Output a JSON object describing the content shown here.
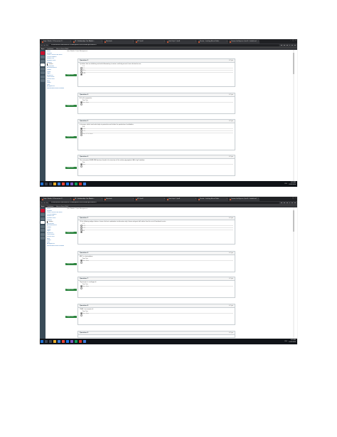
{
  "screens": [
    {
      "tabs": [
        "Topic: Module 3 Discussion (P...",
        "QT - Scholarship - For Module...",
        "Notebook",
        "MT Quiz8",
        "Quiz Help 1 Quiz8",
        "Proctor - Looking Ahead Guide",
        "Canvas Intelligence-Quiz 8 - Lookahead"
      ],
      "url": "fiu.instructure.com/courses/759960/quizzes/780010/take/questions/10",
      "bookmarks": [
        "Apps",
        "Lockdown",
        "Access Saved Rutil"
      ],
      "breadcrumb": "Quiz: Module 3 Quiz 8 Assignment",
      "course_nav": [
        "Home",
        "Syllabus",
        "Online Course Plan Starts",
        "Course Modules",
        "Module Info",
        "Syllabus Items",
        "Modules",
        "Quizzes",
        "Discussions",
        "Announcements",
        "Grades",
        "Collab",
        "Pages",
        "Resources",
        "Office Hours",
        "Course Tools",
        "FAQs",
        "People",
        "Tools",
        "Assignments",
        "Submit Assessment Feedback"
      ],
      "current_nav": "Quizzes",
      "flag_label": "Flag question",
      "questions": [
        {
          "title": "Question 3",
          "points": "0.7 pts",
          "text": "Cytokines that are inhibitory and anti-inflammatory in nature, and help prevent tissue destruction are:",
          "answers": [
            "IL-6",
            "IL-1",
            "TNF-a",
            "IL-10"
          ],
          "selected": 3
        },
        {
          "title": "Question 4",
          "points": "0.7 pts",
          "text": "B-1 cells respond to:",
          "answers": [
            "True, True",
            "False, False"
          ],
          "selected": 0
        },
        {
          "title": "Question 5",
          "points": "0.7 pts",
          "text": "In humans, which interleukin helps to potentiate and initiate the production of antibodies:",
          "answers": [
            "IL-4",
            "IL-10",
            "IL-12",
            "None of the above"
          ],
          "selected": 0
        },
        {
          "title": "Question 6",
          "points": "0.7 pts",
          "text": "The most potent NEFM-CBB has been found in the structure of the surface glycoprotein (Ab) in IgG subclass:",
          "answers": [
            "True",
            "False"
          ],
          "selected": 0
        }
      ]
    },
    {
      "tabs": [
        "Topic: Module 3 Discussion (P...",
        "QT - Scholarship - For Module...",
        "Notebook",
        "MT Quiz8",
        "Quiz Help 1 Quiz8",
        "Proctor - Looking Ahead Guide",
        "Canvas Intelligence-Quiz 8 - Lookahead"
      ],
      "url": "fiu.instructure.com/courses/759960/quizzes/780010/take/questions/10",
      "bookmarks": [
        "Apps",
        "Lockdown",
        "Access Saved Rutil"
      ],
      "breadcrumb": "Quiz: Module 3 Quiz 8 Assignment",
      "course_nav": [
        "Home",
        "Syllabus",
        "Online Course Plan Starts",
        "Course Modules",
        "Module Info",
        "Syllabus Items",
        "Modules",
        "Quizzes",
        "Discussions",
        "Announcements",
        "Grades",
        "Collab",
        "Pages",
        "Resources",
        "Office Hours",
        "Course Tools",
        "FAQs",
        "People",
        "Tools",
        "Assignments",
        "Submit Assessment Feedback"
      ],
      "current_nav": "Quizzes",
      "flag_label": "Flag question",
      "questions": [
        {
          "title": "Question 5",
          "points": "0.7 pts",
          "text": "Of the following antigen factors, choose the best explanation to determine why it bears antigenic drift rather than the rest of functional events:",
          "answers": [
            "IL-4",
            "IL-10",
            "IL-12",
            "IL-1"
          ],
          "selected": 3
        },
        {
          "title": "Question 6",
          "points": "0.7 pts",
          "text": "MHC is a heterodimer:",
          "answers": [
            "True, True",
            "False, False"
          ],
          "selected": 0
        },
        {
          "title": "Question 7",
          "points": "0.7 pts",
          "text": "Thymocytes is a subtype of:",
          "answers": [
            "True, True",
            "False, False"
          ],
          "selected": 0
        },
        {
          "title": "Question 8",
          "points": "0.7 pts",
          "text": "CD40L is a receptor of:",
          "answers": [
            "True, True",
            "False, False"
          ],
          "selected": 0
        },
        {
          "title": "Question 9",
          "points": "0.7 pts",
          "text": "",
          "answers": [],
          "selected": -1
        }
      ]
    }
  ],
  "taskbar": {
    "time": "8:22 AM",
    "date": "10/19/2020",
    "lang": "ENG"
  }
}
